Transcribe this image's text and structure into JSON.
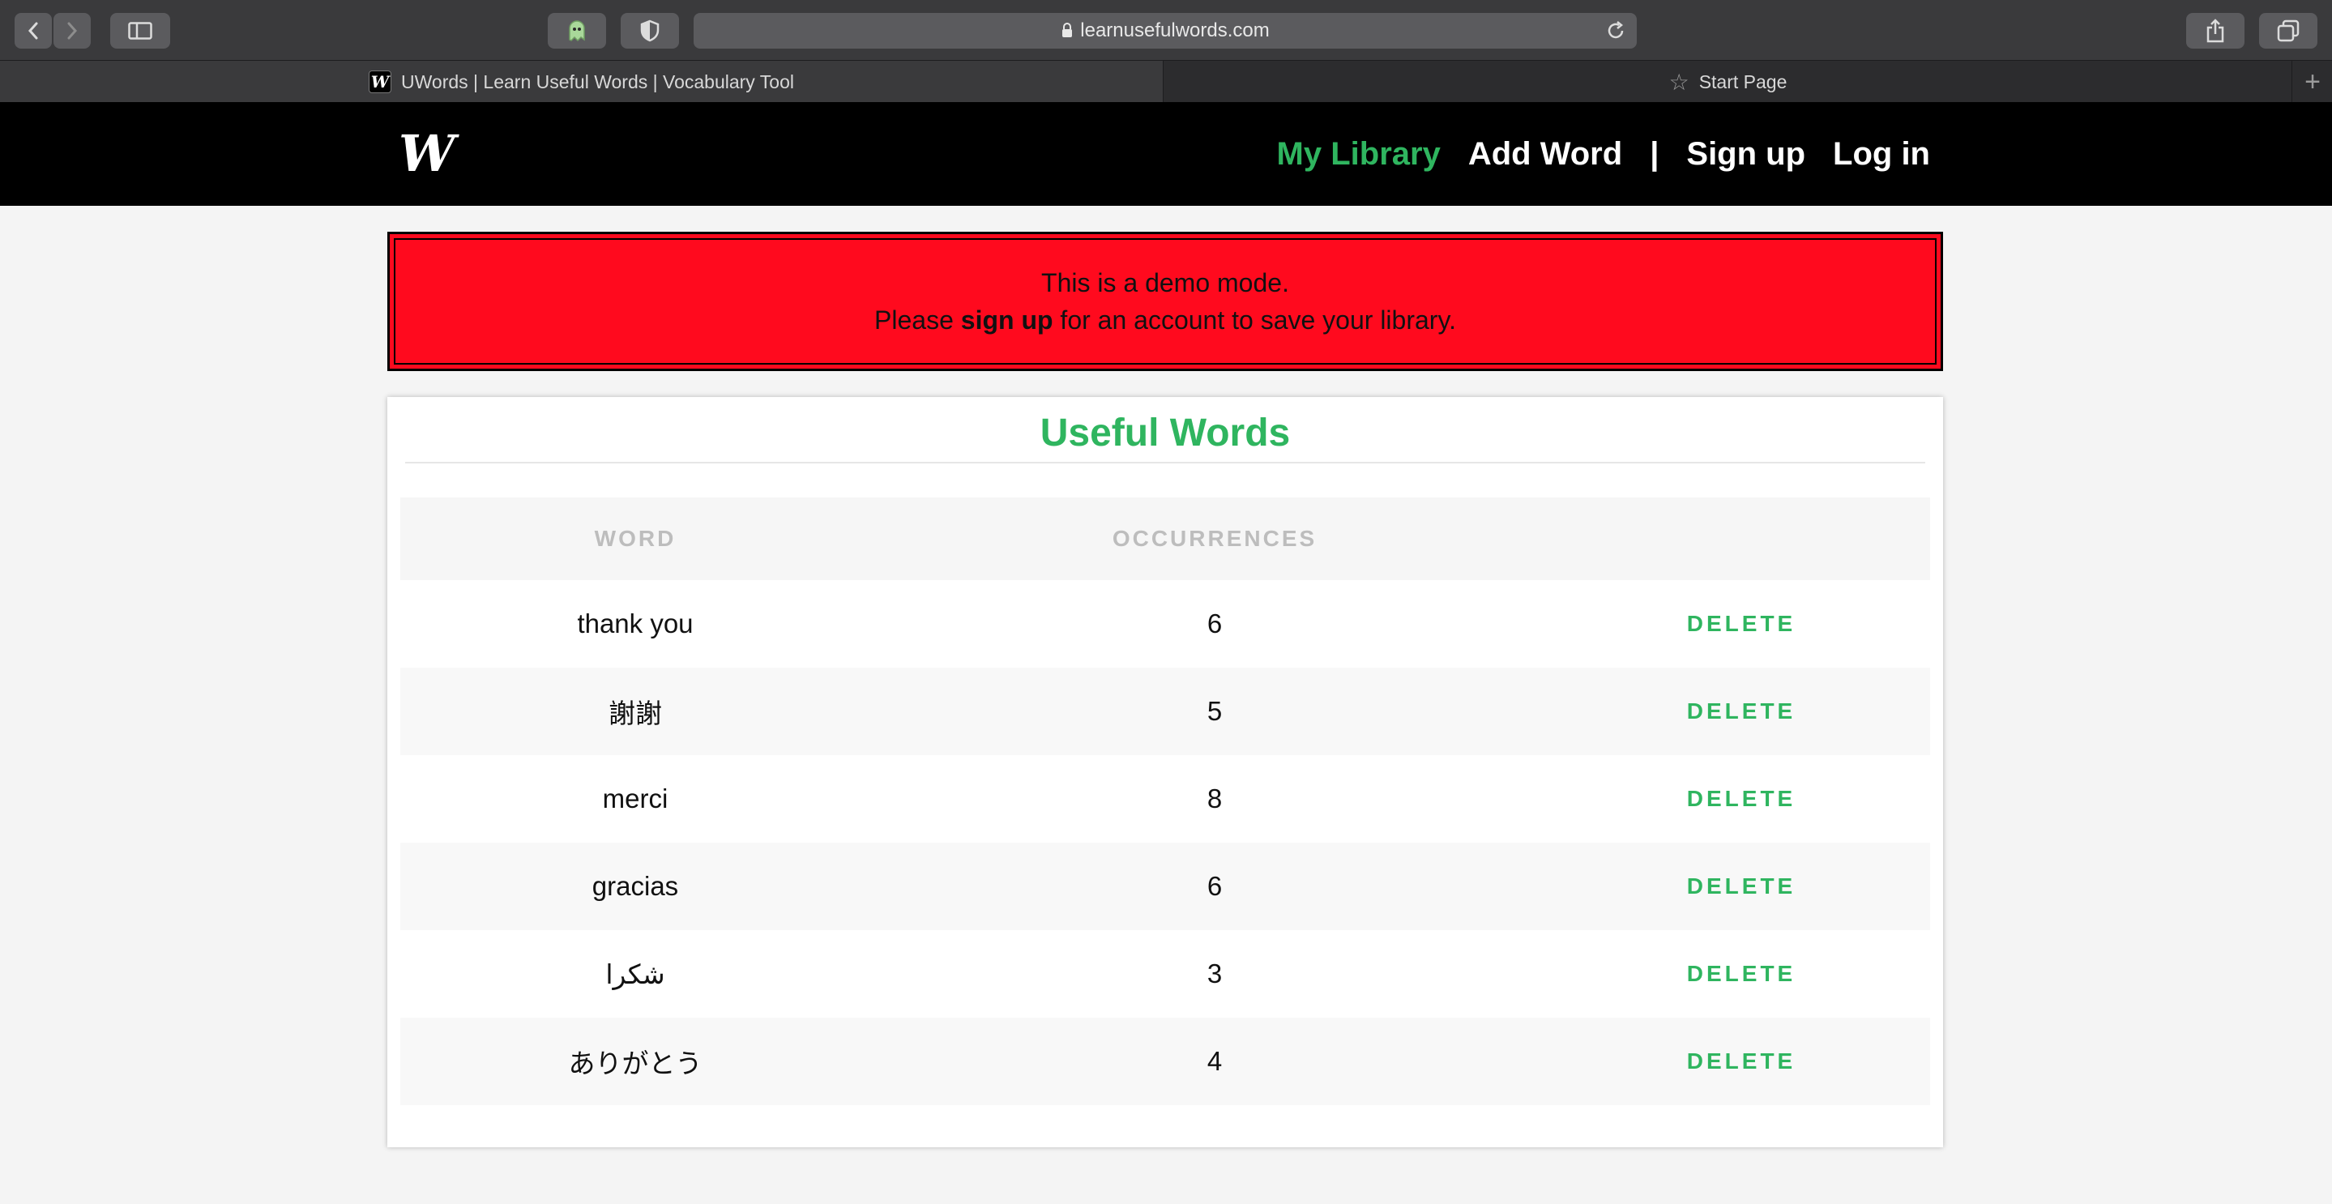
{
  "browser": {
    "url": "learnusefulwords.com",
    "tabs": [
      {
        "title": "UWords | Learn Useful Words | Vocabulary Tool",
        "favicon": "W",
        "active": true
      },
      {
        "title": "Start Page",
        "active": false
      }
    ],
    "icons": [
      "back-icon",
      "forward-icon",
      "sidebar-icon",
      "ghostery-icon",
      "shield-icon",
      "lock-icon",
      "reload-icon",
      "share-icon",
      "tabs-overview-icon",
      "new-tab-icon"
    ]
  },
  "header": {
    "logo": "W",
    "nav": {
      "my_library": "My Library",
      "add_word": "Add Word",
      "separator": "|",
      "sign_up": "Sign up",
      "log_in": "Log in"
    }
  },
  "banner": {
    "line1": "This is a demo mode.",
    "line2_before": "Please ",
    "line2_link": "sign up",
    "line2_after": " for an account to save your library.",
    "color": "#ff0a1e"
  },
  "library": {
    "title": "Useful Words",
    "columns": {
      "word": "WORD",
      "occurrences": "OCCURRENCES",
      "action": ""
    },
    "rows": [
      {
        "word": "thank you",
        "occurrences": "6",
        "action": "DELETE"
      },
      {
        "word": "謝謝",
        "occurrences": "5",
        "action": "DELETE"
      },
      {
        "word": "merci",
        "occurrences": "8",
        "action": "DELETE"
      },
      {
        "word": "gracias",
        "occurrences": "6",
        "action": "DELETE"
      },
      {
        "word": "شكرا",
        "occurrences": "3",
        "action": "DELETE"
      },
      {
        "word": "ありがとう",
        "occurrences": "4",
        "action": "DELETE"
      }
    ]
  },
  "colors": {
    "accent": "#2fb55f",
    "header_bg": "#000000",
    "page_bg": "#f4f4f4"
  }
}
